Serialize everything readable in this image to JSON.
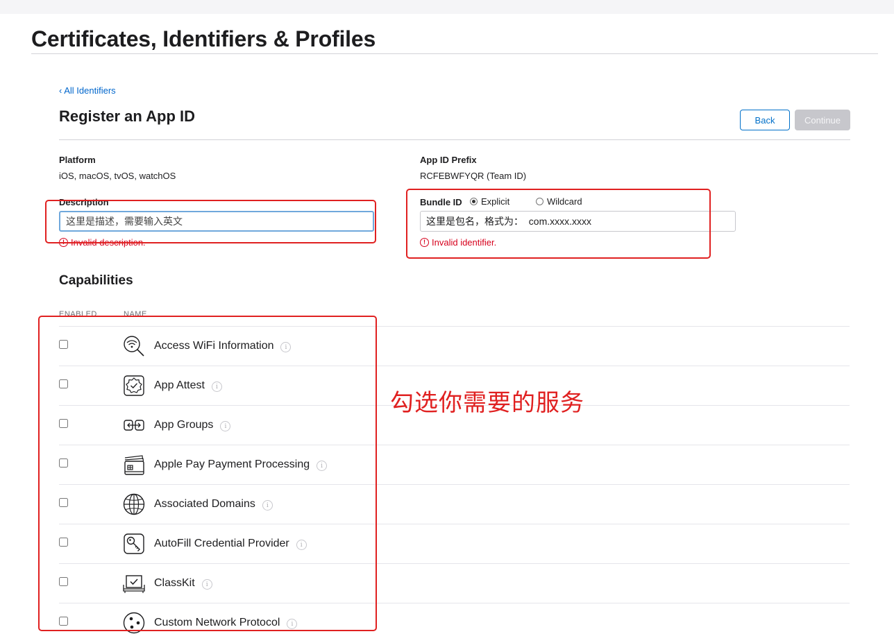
{
  "header": {
    "title": "Certificates, Identifiers & Profiles"
  },
  "nav": {
    "back_link": "‹ All Identifiers"
  },
  "form": {
    "title": "Register an App ID",
    "back_button": "Back",
    "continue_button": "Continue",
    "platform": {
      "label": "Platform",
      "value": "iOS, macOS, tvOS, watchOS"
    },
    "app_id_prefix": {
      "label": "App ID Prefix",
      "value": "RCFEBWFYQR (Team ID)"
    },
    "description": {
      "label": "Description",
      "value": "这里是描述，需要输入英文",
      "error": "Invalid description."
    },
    "bundle_id": {
      "label": "Bundle ID",
      "options": [
        "Explicit",
        "Wildcard"
      ],
      "selected": "Explicit",
      "value": "这里是包名，格式为：  com.xxxx.xxxx",
      "error": "Invalid identifier."
    }
  },
  "capabilities": {
    "title": "Capabilities",
    "columns": [
      "ENABLED",
      "NAME"
    ],
    "items": [
      {
        "name": "Access WiFi Information",
        "icon": "wifi-search-icon",
        "enabled": false
      },
      {
        "name": "App Attest",
        "icon": "badge-check-icon",
        "enabled": false
      },
      {
        "name": "App Groups",
        "icon": "app-groups-icon",
        "enabled": false
      },
      {
        "name": "Apple Pay Payment Processing",
        "icon": "wallet-cards-icon",
        "enabled": false
      },
      {
        "name": "Associated Domains",
        "icon": "globe-icon",
        "enabled": false
      },
      {
        "name": "AutoFill Credential Provider",
        "icon": "key-icon",
        "enabled": false
      },
      {
        "name": "ClassKit",
        "icon": "classkit-icon",
        "enabled": false
      },
      {
        "name": "Custom Network Protocol",
        "icon": "network-dots-icon",
        "enabled": false
      }
    ]
  },
  "annotation": {
    "text": "勾选你需要的服务",
    "color": "#e02020"
  }
}
